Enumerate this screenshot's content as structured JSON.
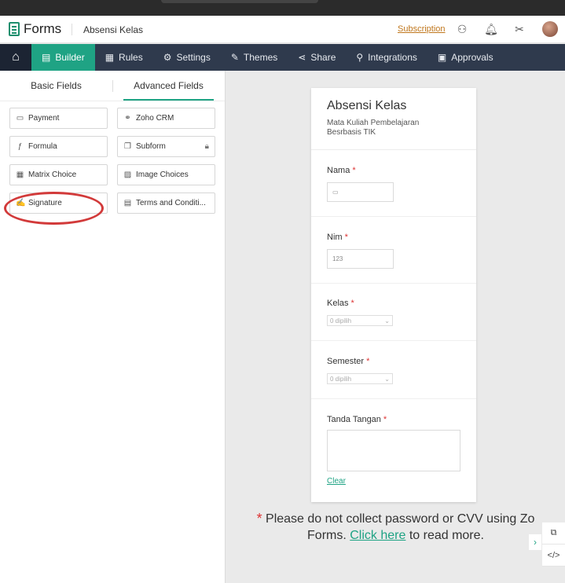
{
  "app": {
    "name": "Forms",
    "form_title": "Absensi Kelas",
    "subscription": "Subscription"
  },
  "nav": {
    "tabs": [
      {
        "label": "Builder",
        "icon": "builder-icon"
      },
      {
        "label": "Rules",
        "icon": "rules-icon"
      },
      {
        "label": "Settings",
        "icon": "gear-icon"
      },
      {
        "label": "Themes",
        "icon": "brush-icon"
      },
      {
        "label": "Share",
        "icon": "share-icon"
      },
      {
        "label": "Integrations",
        "icon": "plug-icon"
      },
      {
        "label": "Approvals",
        "icon": "approvals-icon"
      }
    ]
  },
  "panel": {
    "tabs": [
      "Basic Fields",
      "Advanced Fields"
    ],
    "fields": [
      "Payment",
      "Zoho CRM",
      "Formula",
      "Subform",
      "Matrix Choice",
      "Image Choices",
      "Signature",
      "Terms and Conditi..."
    ]
  },
  "form": {
    "title": "Absensi Kelas",
    "description": "Mata Kuliah Pembelajaran Besrbasis TIK",
    "fields": {
      "nama": {
        "label": "Nama",
        "required": "*"
      },
      "nim": {
        "label": "Nim",
        "required": "*",
        "placeholder": "123"
      },
      "kelas": {
        "label": "Kelas",
        "required": "*",
        "placeholder": "0 dipilih"
      },
      "semester": {
        "label": "Semester",
        "required": "*",
        "placeholder": "0 dipilih"
      },
      "tanda": {
        "label": "Tanda Tangan",
        "required": "*",
        "clear": "Clear"
      }
    }
  },
  "notice": {
    "star": "*",
    "line1": "Please do not collect password or CVV using Zo",
    "line2a": "Forms. ",
    "link": "Click here",
    "line2b": " to read more."
  },
  "colors": {
    "accent": "#1fa384",
    "nav": "#2f3a4d",
    "required": "#dd3333",
    "highlight": "#d23a3a"
  }
}
